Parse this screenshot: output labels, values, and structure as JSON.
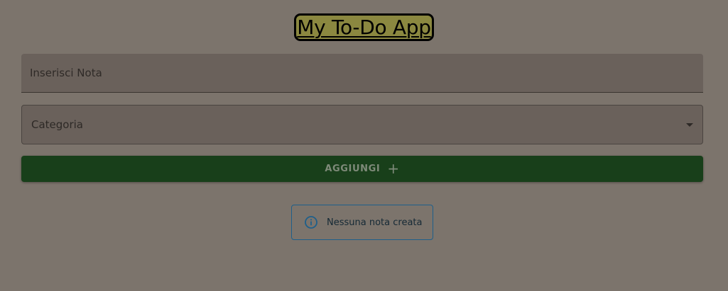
{
  "header": {
    "title": "My To-Do App"
  },
  "form": {
    "note_placeholder": "Inserisci Nota",
    "category_label": "Categoria",
    "add_button_label": "AGGIUNGI",
    "add_icon": "plus-icon"
  },
  "notice": {
    "icon": "info-icon",
    "message": "Nessuna nota creata"
  },
  "colors": {
    "background": "#7c746c",
    "title_background": "#8b8840",
    "button_background": "#183f1a",
    "info_border": "#1e5f8a"
  }
}
